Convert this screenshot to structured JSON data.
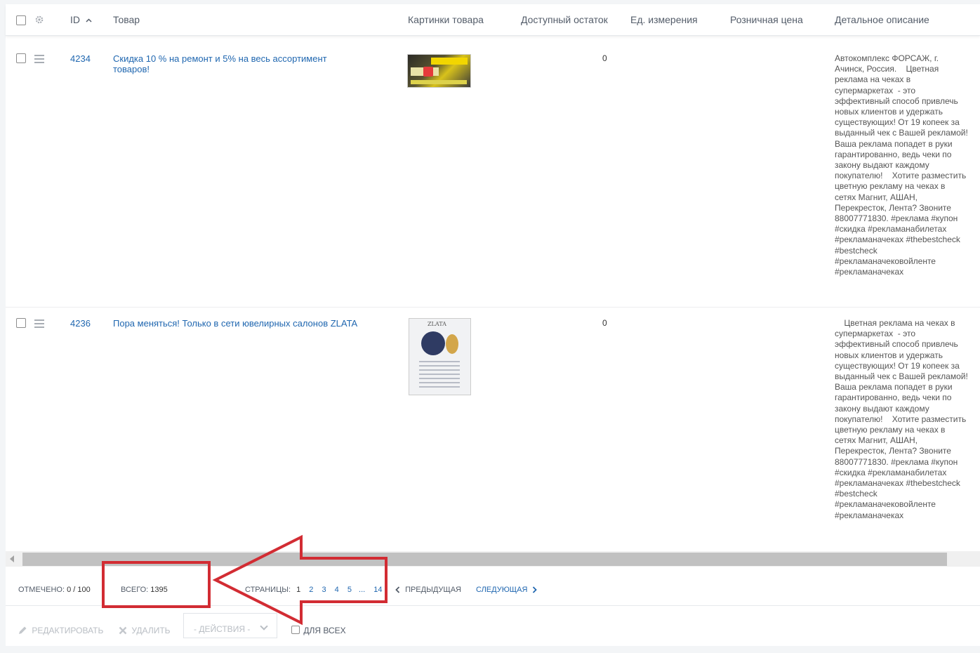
{
  "header": {
    "id": "ID",
    "name": "Товар",
    "images": "Картинки товара",
    "stock": "Доступный остаток",
    "unit": "Ед. измерения",
    "price": "Розничная цена",
    "description": "Детальное описание"
  },
  "rows": [
    {
      "id": "4234",
      "name": "Скидка 10 % на ремонт и 5% на весь ассортимент товаров!",
      "quantity": "0",
      "description": "Автокомплекс ФОРСАЖ, г. Ачинск, Россия.    Цветная реклама на чеках в супермаркетах  - это эффективный способ привлечь новых клиентов и удержать существующих! От 19 копеек за выданный чек с Вашей рекламой! Ваша реклама попадет в руки гарантированно, ведь чеки по закону выдают каждому покупателю!    Хотите разместить цветную рекламу на чеках в сетях Магнит, АШАН, Перекресток, Лента? Звоните 88007771830. #реклама #купон #скидка #рекламанабилетах #рекламаначеках #thebestcheck #bestcheck #рекламаначековойленте #рекламаначеках"
    },
    {
      "id": "4236",
      "name": "Пора меняться! Только в сети ювелирных салонов ZLATA",
      "quantity": "0",
      "description": "    Цветная реклама на чеках в супермаркетах  - это эффективный способ привлечь новых клиентов и удержать существующих! От 19 копеек за выданный чек с Вашей рекламой! Ваша реклама попадет в руки гарантированно, ведь чеки по закону выдают каждому покупателю!    Хотите разместить цветную рекламу на чеках в сетях Магнит, АШАН, Перекресток, Лента? Звоните 88007771830. #реклама #купон #скидка #рекламанабилетах #рекламаначеках #thebestcheck #bestcheck #рекламаначековойленте #рекламаначеках",
      "image_logo": "ZLATA"
    }
  ],
  "footer": {
    "selected_label": "ОТМЕЧЕНО:",
    "selected_value": "0 / 100",
    "total_label": "ВСЕГО:",
    "total_value": "1395",
    "pages_label": "СТРАНИЦЫ:",
    "pages": [
      "1",
      "2",
      "3",
      "4",
      "5",
      "...",
      "14"
    ],
    "prev": "ПРЕДЫДУЩАЯ",
    "next": "СЛЕДУЮЩАЯ"
  },
  "actions": {
    "edit": "РЕДАКТИРОВАТЬ",
    "delete": "УДАЛИТЬ",
    "dropdown": "- ДЕЙСТВИЯ -",
    "for_all": "ДЛЯ ВСЕХ"
  },
  "colors": {
    "link": "#2067b0",
    "annotation": "#d22c33"
  }
}
